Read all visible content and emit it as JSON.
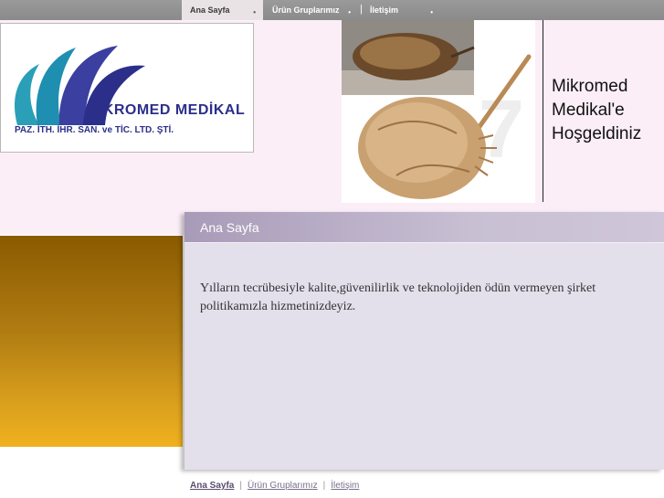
{
  "nav": {
    "items": [
      {
        "label": "Ana Sayfa",
        "active": true
      },
      {
        "label": "Ürün Gruplarımız",
        "active": false
      },
      {
        "label": "İletişim",
        "active": false
      }
    ],
    "separator": "|",
    "bullet": "•"
  },
  "logo": {
    "name": "MİKROMED MEDİKAL",
    "subtitle": "PAZ. İTH. İHR. SAN. ve TİC. LTD. ŞTİ."
  },
  "welcome": {
    "line1": "Mikromed",
    "line2": "Medikal'e",
    "line3": "Hoşgeldiniz"
  },
  "panel": {
    "title": "Ana Sayfa",
    "text": "Yılların tecrübesiyle kalite,güvenilirlik ve teknolojiden ödün vermeyen şirket politikamızla hizmetinizdeyiz."
  },
  "footer": {
    "links": [
      "Ana Sayfa",
      "Ürün Gruplarımız",
      "İletişim"
    ],
    "separator": "|"
  },
  "colors": {
    "brand_blue": "#2b2f8a",
    "brand_teal": "#2a9fb7",
    "header_pink": "#fbeef7",
    "panel_lavender": "#e3dfeb",
    "gold": "#daa01e"
  }
}
